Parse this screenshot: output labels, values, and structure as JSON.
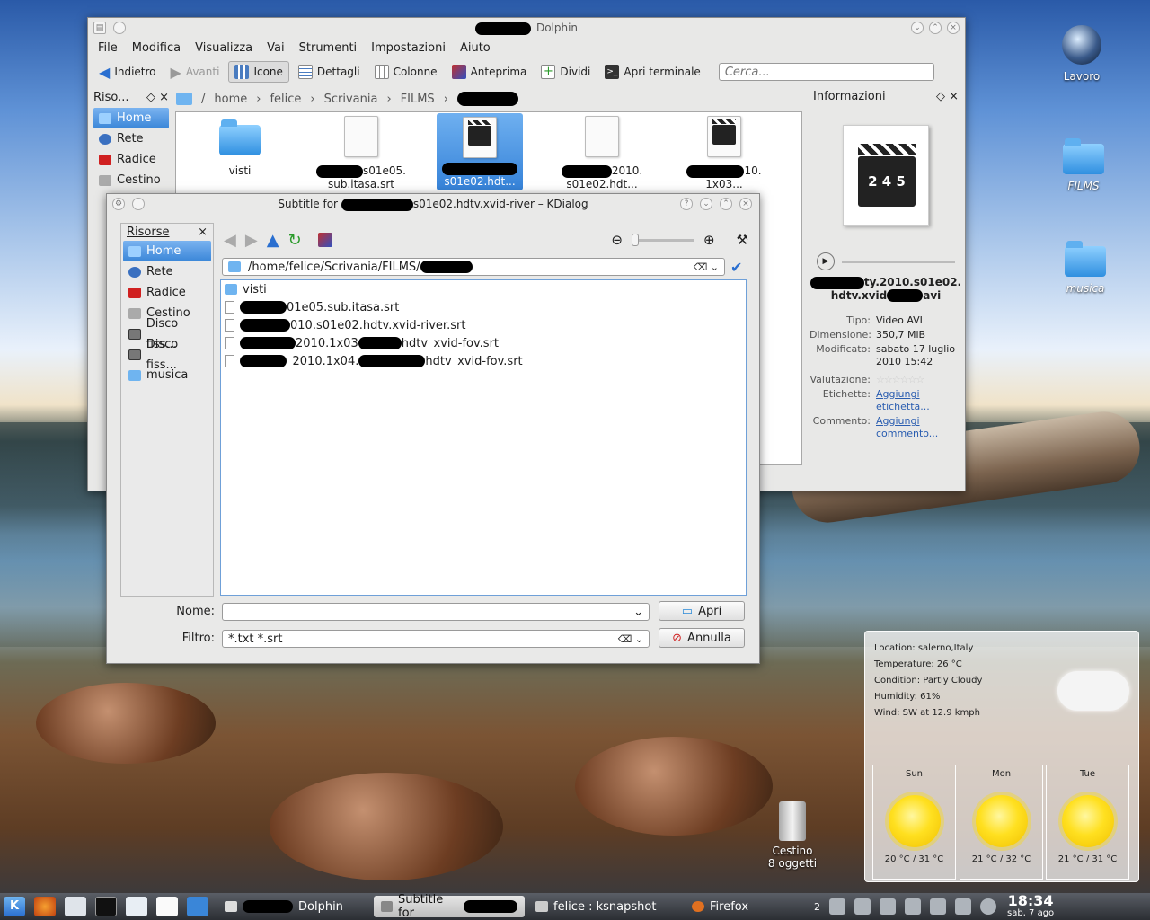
{
  "desktop": {
    "icons": [
      {
        "label": "Lavoro"
      },
      {
        "label": "FILMS"
      },
      {
        "label": "musica"
      }
    ],
    "trash": {
      "label": "Cestino",
      "count": "8 oggetti"
    }
  },
  "dolphin": {
    "title": "Dolphin",
    "menu": [
      "File",
      "Modifica",
      "Visualizza",
      "Vai",
      "Strumenti",
      "Impostazioni",
      "Aiuto"
    ],
    "toolbar": {
      "back": "Indietro",
      "forward": "Avanti",
      "icons": "Icone",
      "details": "Dettagli",
      "columns": "Colonne",
      "preview": "Anteprima",
      "split": "Dividi",
      "terminal": "Apri terminale",
      "search_placeholder": "Cerca..."
    },
    "places_title": "Riso...",
    "places": [
      "Home",
      "Rete",
      "Radice",
      "Cestino"
    ],
    "breadcrumb": [
      "/",
      "home",
      "felice",
      "Scrivania",
      "FILMS"
    ],
    "files": [
      {
        "l1": "visti",
        "l2": ""
      },
      {
        "l1": "s01e05.",
        "l2": "sub.itasa.srt"
      },
      {
        "l1": "s01e02.hdt...",
        "l2": ""
      },
      {
        "l1": "2010.",
        "l2": "s01e02.hdt..."
      },
      {
        "l1": "10.",
        "l2": "1x03..."
      }
    ],
    "info": {
      "title": "Informazioni",
      "name_l1": "ty.2010.s01e02.",
      "name_l2": "hdtv.xvid",
      "name_end": "avi",
      "rows": [
        {
          "k": "Tipo:",
          "v": "Video AVI"
        },
        {
          "k": "Dimensione:",
          "v": "350,7 MiB"
        },
        {
          "k": "Modificato:",
          "v": "sabato 17 luglio 2010 15:42"
        }
      ],
      "rating_label": "Valutazione:",
      "tags_label": "Etichette:",
      "tags_link": "Aggiungi etichetta...",
      "comment_label": "Commento:",
      "comment_link": "Aggiungi commento..."
    },
    "clap_digits": "2 4 5"
  },
  "kdialog": {
    "title_pre": "Subtitle for",
    "title_post": "s01e02.hdtv.xvid-river – KDialog",
    "places_title": "Risorse",
    "places": [
      "Home",
      "Rete",
      "Radice",
      "Cestino",
      "Disco fiss...",
      "Disco fiss...",
      "musica"
    ],
    "path": "/home/felice/Scrivania/FILMS/",
    "files": [
      "visti",
      "01e05.sub.itasa.srt",
      "010.s01e02.hdtv.xvid-river.srt",
      "2010.1x03",
      "hdtv_xvid-fov.srt",
      "_2010.1x04.",
      "hdtv_xvid-fov.srt"
    ],
    "name_label": "Nome:",
    "filter_label": "Filtro:",
    "filter_value": "*.txt *.srt",
    "open": "Apri",
    "cancel": "Annulla"
  },
  "weather": {
    "location": "Location: salerno,Italy",
    "temperature": "Temperature: 26 °C",
    "condition": "Condition: Partly Cloudy",
    "humidity": "Humidity: 61%",
    "wind": "Wind: SW at 12.9 kmph",
    "days": [
      {
        "name": "Sun",
        "temps": "20 °C / 31 °C"
      },
      {
        "name": "Mon",
        "temps": "21 °C / 32 °C"
      },
      {
        "name": "Tue",
        "temps": "21 °C / 31 °C"
      }
    ]
  },
  "taskbar": {
    "tasks": [
      "Dolphin",
      "Subtitle for",
      "felice : ksnapshot",
      "Firefox"
    ],
    "desktop_num": "2",
    "time": "18:34",
    "date": "sab, 7 ago"
  },
  "colors": {
    "accent": "#3a86d8",
    "link": "#2a5db0"
  }
}
